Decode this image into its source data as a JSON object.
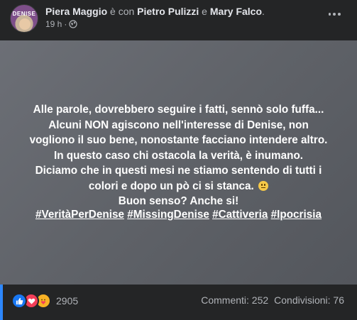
{
  "header": {
    "author": "Piera Maggio",
    "with_text": " è con ",
    "tagged_1": "Pietro Pulizzi",
    "and_text": " e ",
    "tagged_2": "Mary Falco",
    "end_punct": ".",
    "time": "19 h",
    "separator": "·",
    "avatar_text": "DENISE"
  },
  "post": {
    "lines": [
      "Alle parole, dovrebbero seguire i fatti, sennò solo fuffa...",
      "Alcuni NON agiscono nell'interesse di Denise, non",
      "vogliono il suo bene, nonostante facciano intendere altro.",
      "In questo caso chi ostacola la verità, è inumano.",
      "Diciamo che in questi mesi ne stiamo sentendo di tutti i",
      "colori e dopo un pò ci si stanca.",
      "Buon senso? Anche si!"
    ],
    "hashtags": [
      "#VeritàPerDenise",
      "#MissingDenise",
      "#Cattiveria",
      "#Ipocrisia"
    ]
  },
  "footer": {
    "reaction_count": "2905",
    "comments": "Commenti: 252",
    "shares": "Condivisioni: 76"
  },
  "colors": {
    "background": "#242526",
    "card": "#5f6268",
    "text": "#e4e6eb",
    "muted": "#b0b3b8",
    "like": "#1877f2",
    "love": "#f33e58"
  },
  "icons": [
    "globe-icon",
    "more-options-icon",
    "like-reaction-icon",
    "love-reaction-icon",
    "care-reaction-icon",
    "grimacing-emoji-icon"
  ]
}
